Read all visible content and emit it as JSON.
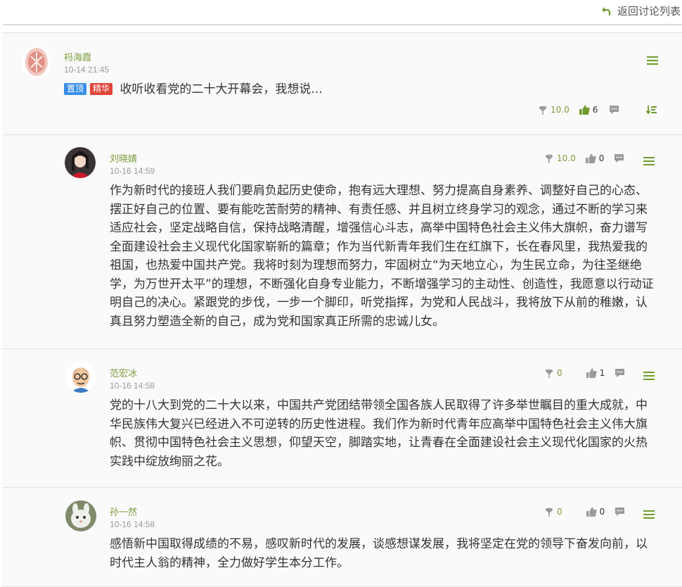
{
  "header": {
    "back_label": "返回讨论列表"
  },
  "main_post": {
    "author": "祃海霞",
    "time": "10-14 21:45",
    "badges": {
      "pinned": "置顶",
      "featured": "精华"
    },
    "title": "收听收看党的二十大开幕会，我想说...",
    "score": "10.0",
    "likes": "6"
  },
  "replies": [
    {
      "author": "刘晓婧",
      "time": "10-16 14:59",
      "score": "10.0",
      "likes": "0",
      "content": "作为新时代的接班人我们要肩负起历史使命，抱有远大理想、努力提高自身素养、调整好自己的心态、摆正好自己的位置、要有能吃苦耐劳的精神、有责任感、并且树立终身学习的观念，通过不断的学习来适应社会，坚定战略自信，保持战略清醒，增强信心斗志，高举中国特色社会主义伟大旗帜，奋力谱写全面建设社会主义现代化国家崭新的篇章；作为当代新青年我们生在红旗下，长在春风里，我热爱我的祖国，也热爱中国共产党。我将时刻为理想而努力，牢固树立“为天地立心，为生民立命，为往圣继绝学，为万世开太平”的理想，不断强化自身专业能力，不断增强学习的主动性、创造性，我愿意以行动证明自己的决心。紧跟党的步伐，一步一个脚印，听党指挥，为党和人民战斗，我将放下从前的稚嫩，认真且努力塑造全新的自己，成为党和国家真正所需的忠诚儿女。"
    },
    {
      "author": "范宏冰",
      "time": "10-16 14:58",
      "score": "0",
      "likes": "1",
      "content": "党的十八大到党的二十大以来，中国共产党团结带领全国各族人民取得了许多举世瞩目的重大成就，中华民族伟大复兴已经进入不可逆转的历史性进程。我们作为新时代青年应高举中国特色社会主义伟大旗帜、贯彻中国特色社会主义思想，仰望天空，脚踏实地，让青春在全面建设社会主义现代化国家的火热实践中绽放绚丽之花。"
    },
    {
      "author": "孙一然",
      "time": "10-16 14:58",
      "score": "0",
      "likes": "0",
      "content": "感悟新中国取得成绩的不易，感叹新时代的发展，谈感想谋发展，我将坚定在党的领导下奋发向前，以时代主人翁的精神，全力做好学生本分工作。"
    }
  ],
  "colors": {
    "accent": "#7c9c3a",
    "pinned": "#3a8ee6",
    "featured": "#e0443a"
  },
  "icons": [
    "return-arrow-icon",
    "menu-icon",
    "flower-score-icon",
    "thumbs-up-icon",
    "comment-icon",
    "sort-icon"
  ]
}
